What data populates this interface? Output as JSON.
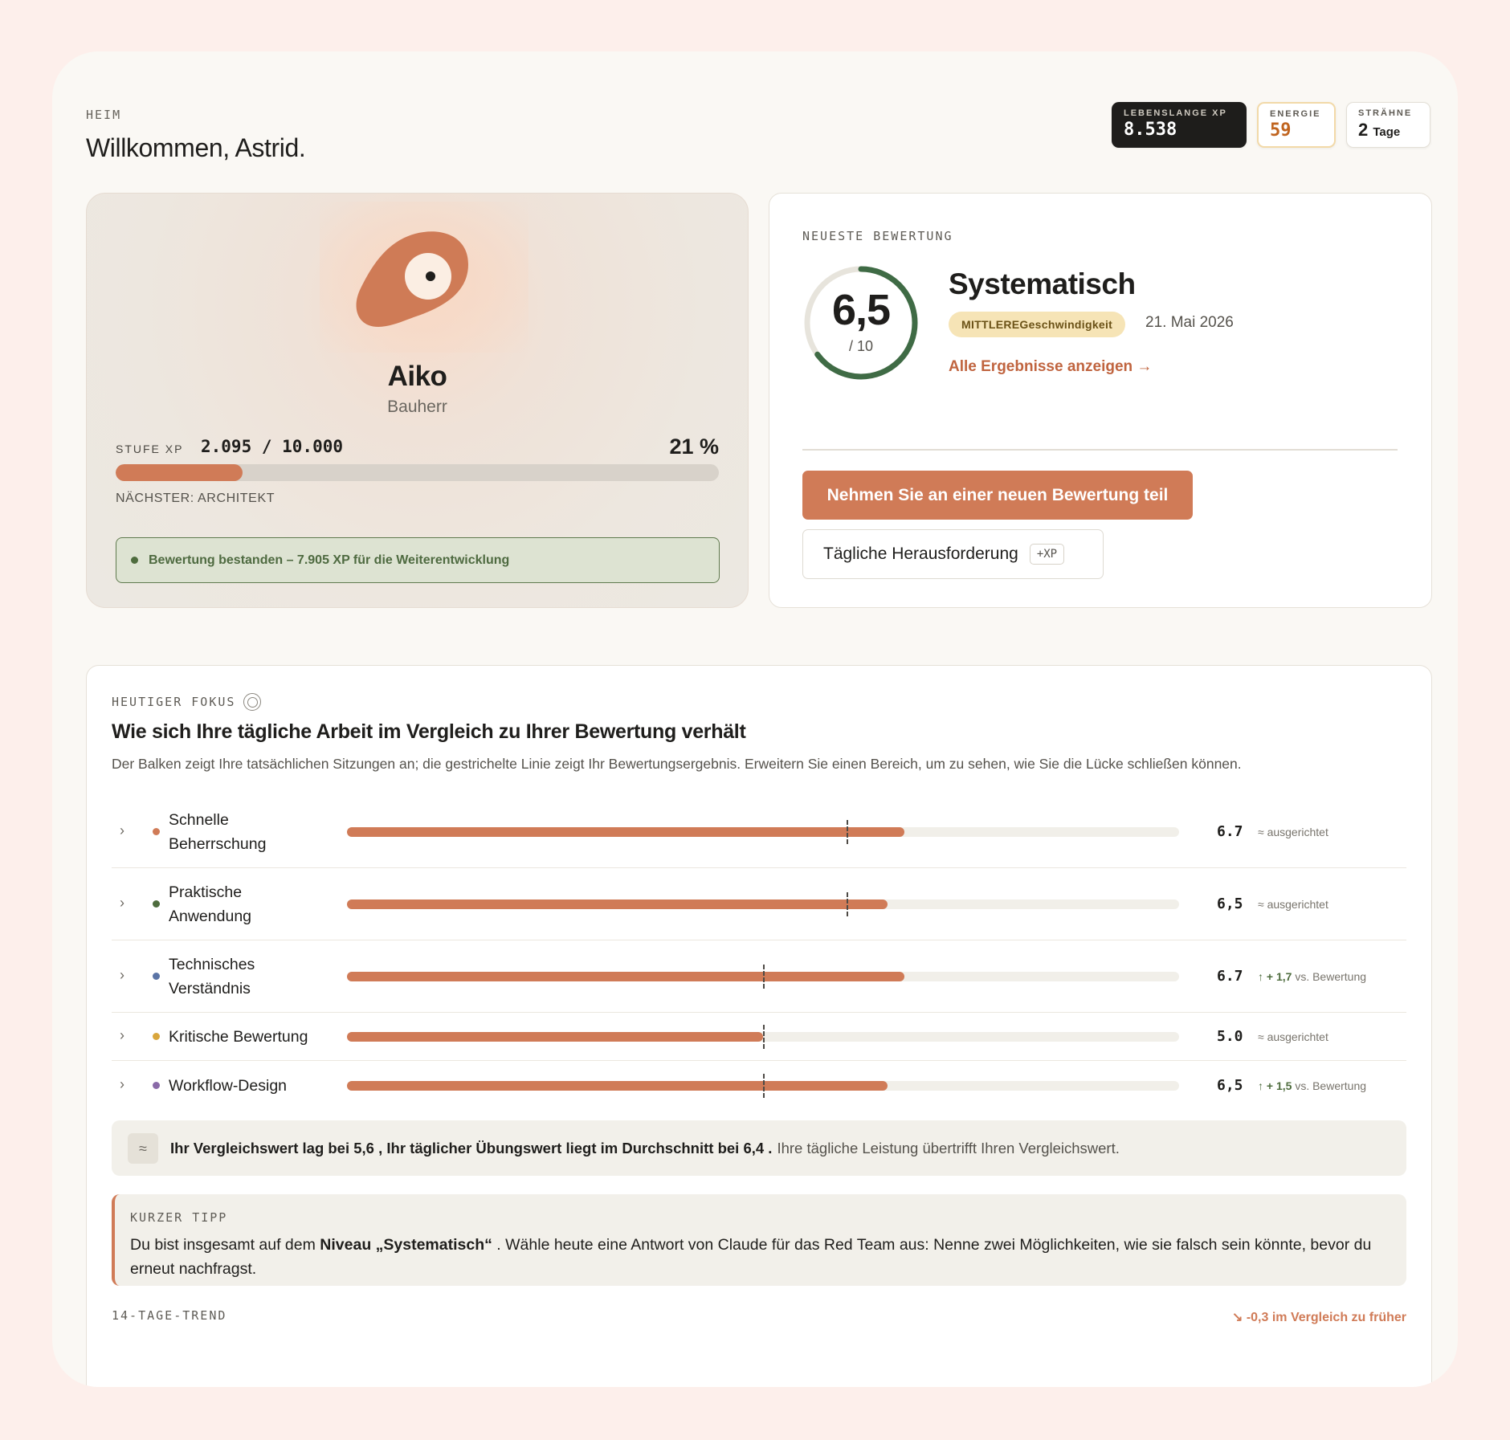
{
  "header": {
    "breadcrumb": "HEIM",
    "welcome": "Willkommen, Astrid."
  },
  "stats": {
    "lifetime_xp": {
      "label": "LEBENSLANGE XP",
      "value": "8.538"
    },
    "energy": {
      "label": "ENERGIE",
      "value": "59"
    },
    "streak": {
      "label": "STRÄHNE",
      "value": "2",
      "unit": "Tage"
    }
  },
  "profile": {
    "name": "Aiko",
    "role": "Bauherr",
    "xp_label": "STUFE XP",
    "xp_value": "2.095 / 10.000",
    "xp_percent_text": "21 %",
    "xp_progress": 0.21,
    "next_level": "NÄCHSTER: ARCHITEKT",
    "passed_note": "Bewertung bestanden – 7.905 XP für die Weiterentwicklung"
  },
  "assessment": {
    "eyebrow": "NEUESTE BEWERTUNG",
    "score": "6,5",
    "score_max": "/ 10",
    "score_fraction": 0.65,
    "title": "Systematisch",
    "badge": "MITTLEREGeschwindigkeit",
    "date": "21. Mai 2026",
    "link": "Alle Ergebnisse anzeigen →",
    "primary_button": "Nehmen Sie an einer neuen Bewertung teil",
    "secondary_button": "Tägliche Herausforderung",
    "secondary_badge": "+XP"
  },
  "focus": {
    "eyebrow": "HEUTIGER FOKUS",
    "title": "Wie sich Ihre tägliche Arbeit im Vergleich zu Ihrer Bewertung verhält",
    "description": "Der Balken zeigt Ihre tatsächlichen Sitzungen an; die gestrichelte Linie zeigt Ihr Bewertungsergebnis. Erweitern Sie einen Bereich, um zu sehen, wie Sie die Lücke schließen können.",
    "rows": [
      {
        "line1": "Schnelle",
        "line2": "Beherrschung",
        "color": "#d07b57",
        "actual": 6.7,
        "assessed": 6.0,
        "score": "6.7",
        "note": "≈ ausgerichtet",
        "delta": ""
      },
      {
        "line1": "Praktische",
        "line2": "Anwendung",
        "color": "#4e6c3e",
        "actual": 6.5,
        "assessed": 6.0,
        "score": "6,5",
        "note": "≈ ausgerichtet",
        "delta": ""
      },
      {
        "line1": "Technisches",
        "line2": "Verständnis",
        "color": "#5b74a6",
        "actual": 6.7,
        "assessed": 5.0,
        "score": "6.7",
        "note": "vs. Bewertung",
        "delta": "↑ + 1,7"
      },
      {
        "line1": "Kritische Bewertung",
        "line2": "",
        "color": "#d9a63c",
        "actual": 5.0,
        "assessed": 5.0,
        "score": "5.0",
        "note": "≈ ausgerichtet",
        "delta": ""
      },
      {
        "line1": "Workflow-Design",
        "line2": "",
        "color": "#8a6aa8",
        "actual": 6.5,
        "assessed": 5.0,
        "score": "6,5",
        "note": "vs. Bewertung",
        "delta": "↑ + 1,5"
      }
    ],
    "summary_icon": "≈",
    "summary_bold": "Ihr Vergleichswert lag bei 5,6 , Ihr täglicher Übungswert liegt im Durchschnitt bei 6,4 .",
    "summary_rest": "Ihre tägliche Leistung übertrifft Ihren Vergleichswert.",
    "tip_eyebrow": "KURZER TIPP",
    "tip_prefix": "Du bist insgesamt auf dem ",
    "tip_bold": "Niveau „Systematisch“",
    "tip_suffix": " . Wähle heute eine Antwort von Claude für das Red Team aus: Nenne zwei Möglichkeiten, wie sie falsch sein könnte, bevor du erneut nachfragst.",
    "trend_label": "14-TAGE-TREND",
    "trend_value": "↘ -0,3 im Vergleich zu früher"
  },
  "colors": {
    "accent": "#d07b57",
    "ring": "#3f6b45",
    "success": "#4e6c3e"
  }
}
